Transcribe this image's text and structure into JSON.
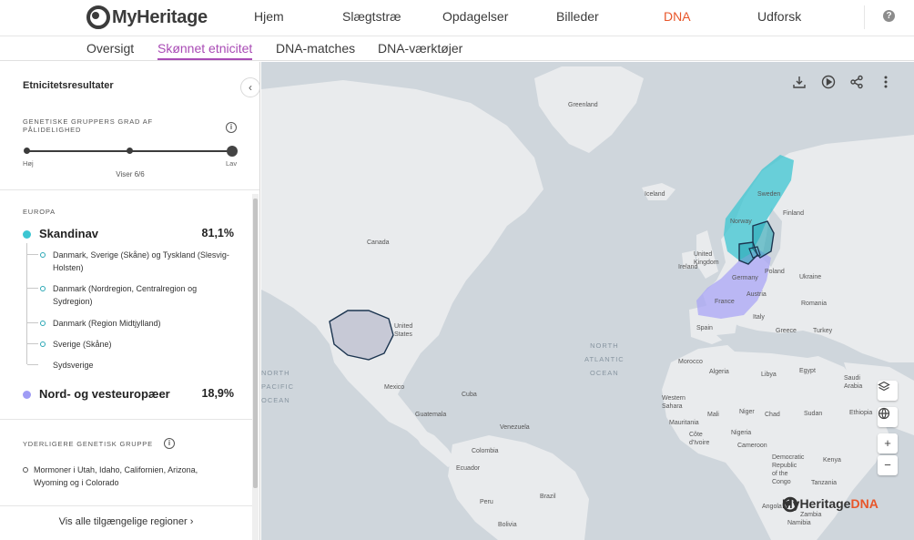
{
  "brand": {
    "name": "MyHeritage",
    "logo_dna": "DNA",
    "accent": "#e8562a",
    "purple": "#a94bb5"
  },
  "nav": {
    "items": [
      {
        "label": "Hjem"
      },
      {
        "label": "Slægtstræ"
      },
      {
        "label": "Opdagelser"
      },
      {
        "label": "Billeder"
      },
      {
        "label": "DNA"
      },
      {
        "label": "Udforsk"
      }
    ],
    "active": "DNA",
    "help_icon": "help-icon"
  },
  "subnav": {
    "items": [
      {
        "label": "Oversigt"
      },
      {
        "label": "Skønnet etnicitet"
      },
      {
        "label": "DNA-matches"
      },
      {
        "label": "DNA-værktøjer"
      }
    ],
    "active": "Skønnet etnicitet"
  },
  "panel": {
    "title": "Etnicitetsresultater",
    "confidence_label": "GENETISKE GRUPPERS GRAD AF PÅLIDELIGHED",
    "slider": {
      "low_label": "Høj",
      "high_label": "Lav",
      "count_text": "Viser 6/6",
      "value": 6,
      "max": 6
    },
    "region_label": "EUROPA",
    "ethnicities": [
      {
        "name": "Skandinav",
        "percent": "81,1%",
        "color": "#3cc6d2",
        "subgroups": [
          "Danmark, Sverige (Skåne) og Tyskland (Slesvig-Holsten)",
          "Danmark (Nordregion, Centralregion og Sydregion)",
          "Danmark (Region Midtjylland)",
          "Sverige (Skåne)",
          "Sydsverige"
        ]
      },
      {
        "name": "Nord- og vesteuropæer",
        "percent": "18,9%",
        "color": "#9f9cf5"
      }
    ],
    "additional_label": "YDERLIGERE GENETISK GRUPPE",
    "additional_items": [
      "Mormoner i Utah, Idaho, Californien, Arizona, Wyoming og i Colorado"
    ],
    "see_all": "Vis alle tilgængelige regioner"
  },
  "map": {
    "labels": {
      "greenland": "Greenland",
      "iceland": "Iceland",
      "sweden": "Sweden",
      "finland": "Finland",
      "norway": "Norway",
      "canada": "Canada",
      "united_kingdom": "United\nKingdom",
      "ireland": "Ireland",
      "germany": "Germany",
      "poland": "Poland",
      "ukraine": "Ukraine",
      "france": "France",
      "austria": "Austria",
      "romania": "Romania",
      "spain": "Spain",
      "italy": "Italy",
      "greece": "Greece",
      "turkey": "Turkey",
      "united_states": "United\nStates",
      "morocco": "Morocco",
      "algeria": "Algeria",
      "libya": "Libya",
      "egypt": "Egypt",
      "western_sahara": "Western\nSahara",
      "mali": "Mali",
      "niger": "Niger",
      "chad": "Chad",
      "sudan": "Sudan",
      "mauritania": "Mauritania",
      "nigeria": "Nigeria",
      "ethiopia": "Ethiopia",
      "cote_divoire": "Côte\nd'Ivoire",
      "cameroon": "Cameroon",
      "kenya": "Kenya",
      "mexico": "Mexico",
      "cuba": "Cuba",
      "guatemala": "Guatemala",
      "venezuela": "Venezuela",
      "colombia": "Colombia",
      "ecuador": "Ecuador",
      "peru": "Peru",
      "brazil": "Brazil",
      "bolivia": "Bolivia",
      "angola": "Angola",
      "dr_congo": "Democratic\nRepublic\nof the\nCongo",
      "tanzania": "Tanzania",
      "zambia": "Zambia",
      "namibia": "Namibia",
      "saudi_arabia": "Saudi\nArabia"
    },
    "ocean_north_atlantic": "NORTH\nATLANTIC\nOCEAN",
    "ocean_north_pacific": "NORTH\nPACIFIC\nOCEAN",
    "tools": [
      "download-icon",
      "play-icon",
      "share-icon",
      "more-icon"
    ],
    "controls": [
      "layers-icon",
      "globe-icon",
      "zoom-in-icon",
      "zoom-out-icon"
    ],
    "logo_text": "MyHeritage",
    "logo_dna": "DNA"
  }
}
